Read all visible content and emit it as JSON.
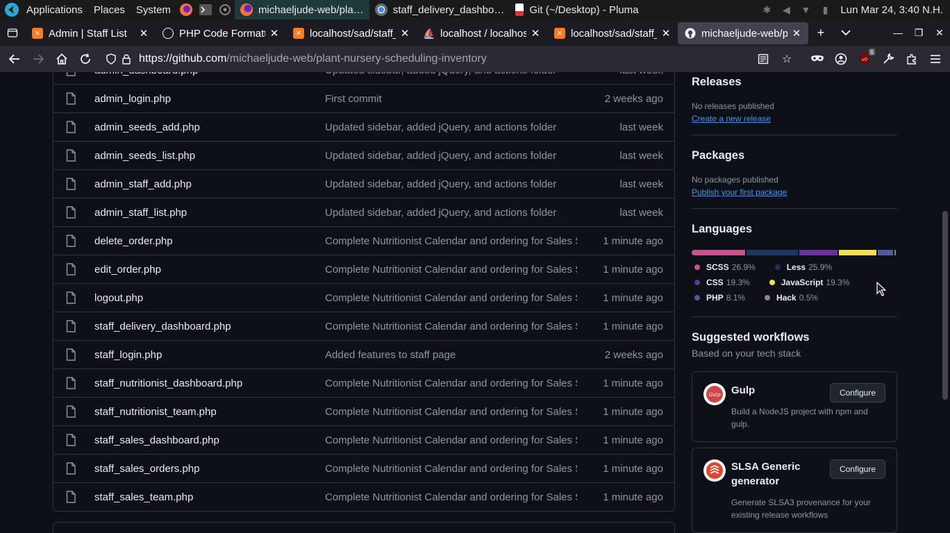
{
  "os_panel": {
    "menus": [
      "Applications",
      "Places",
      "System"
    ],
    "tasks": [
      {
        "label": "michaeljude-web/pla…",
        "active": true,
        "icon": "firefox-icon"
      },
      {
        "label": "staff_delivery_dashbo…",
        "active": false,
        "icon": "chrome-icon"
      },
      {
        "label": "Git (~/Desktop) - Pluma",
        "active": false,
        "icon": "pluma-icon"
      }
    ],
    "clock": "Lun Mar 24,  3:40 N.H."
  },
  "browser": {
    "tabs": [
      {
        "label": "Admin | Staff List",
        "favicon": "xampp-icon",
        "selected": false
      },
      {
        "label": "PHP Code Formatting",
        "favicon": "openai-icon",
        "selected": false
      },
      {
        "label": "localhost/sad/staff_",
        "favicon": "xampp-icon",
        "selected": false
      },
      {
        "label": "localhost / localhost",
        "favicon": "phpmyadmin-icon",
        "selected": false
      },
      {
        "label": "localhost/sad/staff_",
        "favicon": "xampp-icon",
        "selected": false
      },
      {
        "label": "michaeljude-web/pl",
        "favicon": "github-icon",
        "selected": true
      }
    ],
    "url": {
      "host": "https://github.com",
      "path": "/michaeljude-web/plant-nursery-scheduling-inventory"
    },
    "ublock_badge": "6"
  },
  "files": [
    {
      "name": "admin_dashboard.php",
      "message": "Updated sidebar, added jQuery, and actions folder",
      "time": "last week"
    },
    {
      "name": "admin_login.php",
      "message": "First commit",
      "time": "2 weeks ago"
    },
    {
      "name": "admin_seeds_add.php",
      "message": "Updated sidebar, added jQuery, and actions folder",
      "time": "last week"
    },
    {
      "name": "admin_seeds_list.php",
      "message": "Updated sidebar, added jQuery, and actions folder",
      "time": "last week"
    },
    {
      "name": "admin_staff_add.php",
      "message": "Updated sidebar, added jQuery, and actions folder",
      "time": "last week"
    },
    {
      "name": "admin_staff_list.php",
      "message": "Updated sidebar, added jQuery, and actions folder",
      "time": "last week"
    },
    {
      "name": "delete_order.php",
      "message": "Complete Nutritionist Calendar and ordering for Sales Staff",
      "time": "1 minute ago"
    },
    {
      "name": "edit_order.php",
      "message": "Complete Nutritionist Calendar and ordering for Sales Staff",
      "time": "1 minute ago"
    },
    {
      "name": "logout.php",
      "message": "Complete Nutritionist Calendar and ordering for Sales Staff",
      "time": "1 minute ago"
    },
    {
      "name": "staff_delivery_dashboard.php",
      "message": "Complete Nutritionist Calendar and ordering for Sales Staff",
      "time": "1 minute ago"
    },
    {
      "name": "staff_login.php",
      "message": "Added features to staff page",
      "time": "2 weeks ago"
    },
    {
      "name": "staff_nutritionist_dashboard.php",
      "message": "Complete Nutritionist Calendar and ordering for Sales Staff",
      "time": "1 minute ago"
    },
    {
      "name": "staff_nutritionist_team.php",
      "message": "Complete Nutritionist Calendar and ordering for Sales Staff",
      "time": "1 minute ago"
    },
    {
      "name": "staff_sales_dashboard.php",
      "message": "Complete Nutritionist Calendar and ordering for Sales Staff",
      "time": "1 minute ago"
    },
    {
      "name": "staff_sales_orders.php",
      "message": "Complete Nutritionist Calendar and ordering for Sales Staff",
      "time": "1 minute ago"
    },
    {
      "name": "staff_sales_team.php",
      "message": "Complete Nutritionist Calendar and ordering for Sales Staff",
      "time": "1 minute ago"
    }
  ],
  "sidebar": {
    "releases": {
      "title": "Releases",
      "note": "No releases published",
      "link": "Create a new release"
    },
    "packages": {
      "title": "Packages",
      "note": "No packages published",
      "link": "Publish your first package"
    },
    "languages": {
      "title": "Languages",
      "items": [
        {
          "name": "SCSS",
          "percent": "26.9%",
          "value": 26.9,
          "color": "#c6538c"
        },
        {
          "name": "Less",
          "percent": "25.9%",
          "value": 25.9,
          "color": "#1d365d"
        },
        {
          "name": "CSS",
          "percent": "19.3%",
          "value": 19.3,
          "color": "#663399"
        },
        {
          "name": "JavaScript",
          "percent": "19.3%",
          "value": 19.3,
          "color": "#f1e05a"
        },
        {
          "name": "PHP",
          "percent": "8.1%",
          "value": 8.1,
          "color": "#4f5d95"
        },
        {
          "name": "Hack",
          "percent": "0.5%",
          "value": 0.5,
          "color": "#878787"
        }
      ]
    },
    "workflows": {
      "title": "Suggested workflows",
      "subtitle": "Based on your tech stack",
      "cards": [
        {
          "title": "Gulp",
          "description": "Build a NodeJS project with npm and gulp.",
          "button": "Configure",
          "logo": "gulp-icon"
        },
        {
          "title": "SLSA Generic generator",
          "description": "Generate SLSA3 provenance for your existing release workflows",
          "button": "Configure",
          "logo": "slsa-icon"
        }
      ]
    }
  }
}
